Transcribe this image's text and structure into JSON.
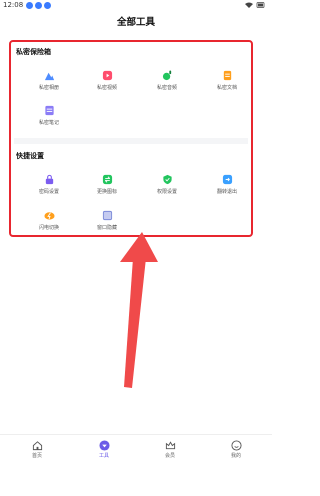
{
  "status_bar": {
    "time": "12:08"
  },
  "page": {
    "title": "全部工具"
  },
  "sections": [
    {
      "title": "私密保险箱",
      "items": [
        {
          "label": "私密相册",
          "icon": "photo-icon",
          "color": "#4e8cff"
        },
        {
          "label": "私密视频",
          "icon": "video-icon",
          "color": "#ff4d6d"
        },
        {
          "label": "私密音频",
          "icon": "audio-icon",
          "color": "#22c55e"
        },
        {
          "label": "私密文档",
          "icon": "document-icon",
          "color": "#ff9f1c"
        },
        {
          "label": "私密笔记",
          "icon": "note-icon",
          "color": "#8b7cf6"
        }
      ]
    },
    {
      "title": "快捷设置",
      "items": [
        {
          "label": "密码设置",
          "icon": "lock-icon",
          "color": "#7b5cf0"
        },
        {
          "label": "更换图标",
          "icon": "swap-icon",
          "color": "#22c55e"
        },
        {
          "label": "权限设置",
          "icon": "shield-icon",
          "color": "#22c55e"
        },
        {
          "label": "翻转退出",
          "icon": "flip-exit-icon",
          "color": "#3aa0ff"
        },
        {
          "label": "闪电切换",
          "icon": "lightning-icon",
          "color": "#ff9f1c"
        },
        {
          "label": "窗口隐藏",
          "icon": "window-icon",
          "color": "#7c8bd9"
        }
      ]
    }
  ],
  "tabbar": {
    "items": [
      {
        "label": "首页",
        "icon": "home-icon",
        "active": false
      },
      {
        "label": "工具",
        "icon": "tools-icon",
        "active": true
      },
      {
        "label": "会员",
        "icon": "crown-icon",
        "active": false
      },
      {
        "label": "我的",
        "icon": "profile-icon",
        "active": false
      }
    ]
  },
  "colors": {
    "highlight": "#e8262f",
    "accent": "#6c5ce7"
  }
}
